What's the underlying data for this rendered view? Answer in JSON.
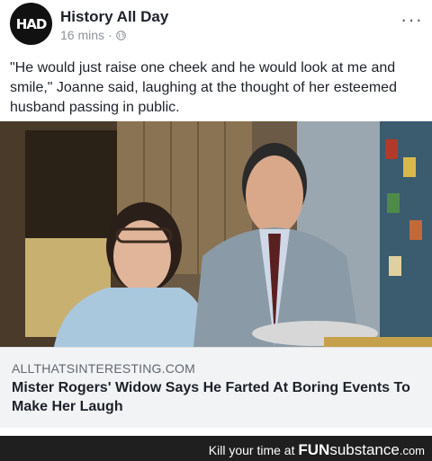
{
  "post": {
    "avatar_text": "HAD",
    "page_name": "History All Day",
    "time": "16 mins",
    "separator": "·",
    "text": "\"He would just raise one cheek and he would look at me and smile,\" Joanne said, laughing at the thought of her esteemed husband passing in public.",
    "more_label": "···"
  },
  "link": {
    "domain": "ALLTHATSINTERESTING.COM",
    "title": "Mister Rogers' Widow Says He Farted At Boring Events To Make Her Laugh"
  },
  "footer": {
    "tagline": "Kill your time at",
    "brand_bold": "FUN",
    "brand_rest": "substance",
    "brand_tld": ".com"
  },
  "icons": [
    "globe-icon",
    "more-options-icon"
  ],
  "colors": {
    "footer_bg": "#1f1f1f",
    "meta_gray": "#90949c",
    "link_box": "#f2f3f5"
  }
}
